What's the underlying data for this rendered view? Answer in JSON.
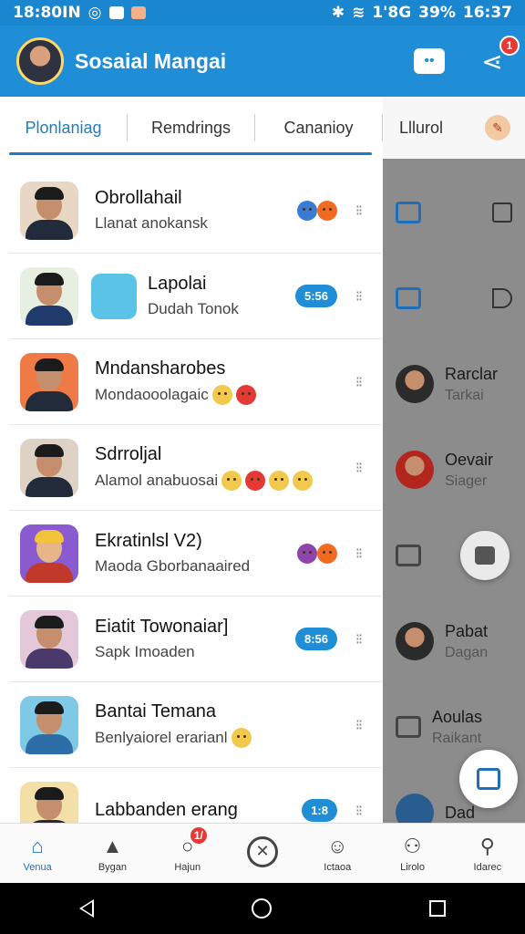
{
  "status": {
    "left_text": "18:80IN",
    "right_text": "1'8G",
    "battery": "39%",
    "time": "16:37"
  },
  "appbar": {
    "title": "Sosaial Mangai",
    "share_badge": "1"
  },
  "tabs": [
    {
      "label": "Plonlaniag",
      "active": true
    },
    {
      "label": "Remdrings",
      "active": false
    },
    {
      "label": "Cananioy",
      "active": false
    }
  ],
  "tabs_right": {
    "label": "Lllurol"
  },
  "rows": [
    {
      "name": "Obrollahail",
      "sub": "Llanat anokansk",
      "pill": "",
      "reacts": [
        "blue",
        "org"
      ]
    },
    {
      "name": "Lapolai",
      "sub": "Dudah Tonok",
      "pill": "5:56",
      "reacts": []
    },
    {
      "name": "Mndansharobes",
      "sub": "Mondaooolagaic",
      "pill": "",
      "reacts": [],
      "emojis": [
        "yellow",
        "red"
      ]
    },
    {
      "name": "Sdrroljal",
      "sub": "Alamol anabuosai",
      "pill": "",
      "reacts": [],
      "emojis": [
        "yellow",
        "red",
        "yellow",
        "yellow"
      ]
    },
    {
      "name": "Ekratinlsl V2)",
      "sub": "Maoda Gborbanaaired",
      "pill": "",
      "reacts": [
        "purple",
        "org"
      ]
    },
    {
      "name": "Eiatit Towonaiar]",
      "sub": "Sapk Imoaden",
      "pill": "8:56",
      "reacts": []
    },
    {
      "name": "Bantai Temana",
      "sub": "Benlyaiorel erarianl",
      "pill": "",
      "reacts": [],
      "emojis": [
        "yellow"
      ]
    },
    {
      "name": "Labbanden erang",
      "sub": "",
      "pill": "1:8",
      "reacts": []
    }
  ],
  "right_panel": [
    {
      "name": "",
      "sub": ""
    },
    {
      "name": "",
      "sub": ""
    },
    {
      "name": "Rarclar",
      "sub": "Tarkai"
    },
    {
      "name": "Oevair",
      "sub": "Siager"
    },
    {
      "name": "",
      "sub": ""
    },
    {
      "name": "Pabat",
      "sub": "Dagan"
    },
    {
      "name": "Aoulas",
      "sub": "Raikant"
    },
    {
      "name": "Dad",
      "sub": ""
    }
  ],
  "bottomnav": [
    {
      "label": "Venua",
      "icon": "home-icon"
    },
    {
      "label": "Bygan",
      "icon": "thumb-icon"
    },
    {
      "label": "Hajun",
      "icon": "search-icon",
      "badge": "1/"
    },
    {
      "label": "",
      "icon": "close-circle-icon"
    },
    {
      "label": "Ictaoa",
      "icon": "smile-icon"
    },
    {
      "label": "Lirolo",
      "icon": "person-icon"
    },
    {
      "label": "Idarec",
      "icon": "profile-icon"
    }
  ],
  "colors": {
    "primary": "#1f8ed6",
    "accent": "#1b7dc4",
    "badge": "#e53935"
  }
}
